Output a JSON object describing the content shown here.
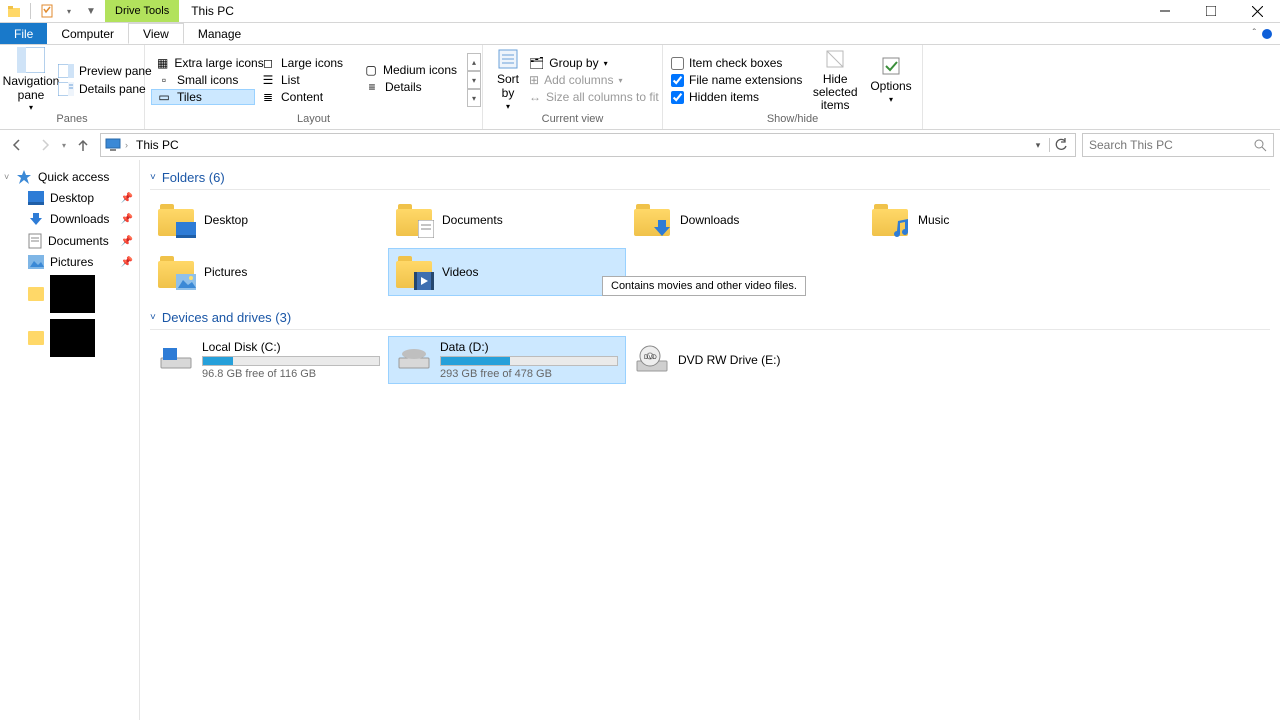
{
  "title": "This PC",
  "context_tab": "Drive Tools",
  "tabs": {
    "file": "File",
    "computer": "Computer",
    "view": "View",
    "manage": "Manage"
  },
  "ribbon": {
    "panes": {
      "label": "Panes",
      "navigation": "Navigation pane",
      "preview": "Preview pane",
      "details": "Details pane"
    },
    "layout": {
      "label": "Layout",
      "items": [
        "Extra large icons",
        "Large icons",
        "Medium icons",
        "Small icons",
        "List",
        "Details",
        "Tiles",
        "Content"
      ]
    },
    "current_view": {
      "label": "Current view",
      "sort": "Sort by",
      "group": "Group by",
      "add_cols": "Add columns",
      "size_cols": "Size all columns to fit"
    },
    "show_hide": {
      "label": "Show/hide",
      "item_chk": "Item check boxes",
      "ext": "File name extensions",
      "hidden": "Hidden items",
      "hide_sel": "Hide selected items",
      "options": "Options"
    }
  },
  "breadcrumb": {
    "root": "This PC"
  },
  "search_placeholder": "Search This PC",
  "sidebar": {
    "quick": "Quick access",
    "items": [
      "Desktop",
      "Downloads",
      "Documents",
      "Pictures"
    ]
  },
  "folders": {
    "header": "Folders (6)",
    "items": [
      "Desktop",
      "Documents",
      "Downloads",
      "Music",
      "Pictures",
      "Videos"
    ]
  },
  "tooltip": "Contains movies and other video files.",
  "drives": {
    "header": "Devices and drives (3)",
    "items": [
      {
        "name": "Local Disk (C:)",
        "free": "96.8 GB free of 116 GB",
        "pct": 17
      },
      {
        "name": "Data (D:)",
        "free": "293 GB free of 478 GB",
        "pct": 39
      },
      {
        "name": "DVD RW Drive (E:)"
      }
    ]
  }
}
